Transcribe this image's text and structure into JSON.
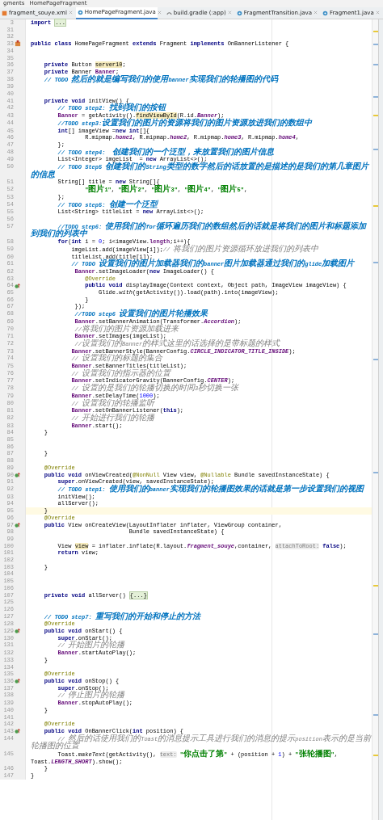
{
  "breadcrumb": [
    "gments",
    "HomePageFragment"
  ],
  "tabs": [
    {
      "label": "fragment_souye.xml",
      "kind": "xml",
      "selected": false
    },
    {
      "label": "HomePageFragment.java",
      "kind": "class",
      "selected": true
    },
    {
      "label": "build.gradle (:app)",
      "kind": "gradle",
      "selected": false
    },
    {
      "label": "FragmentTransition.java",
      "kind": "class",
      "selected": false
    },
    {
      "label": "Fragment1.java",
      "kind": "class",
      "selected": false
    }
  ],
  "lines": [
    {
      "no": "3",
      "current": false,
      "code": [
        {
          "kind": "kw",
          "text": "import "
        },
        {
          "kind": "folded",
          "text": "..."
        }
      ]
    },
    {
      "no": "31",
      "current": false
    },
    {
      "no": "32",
      "current": false
    },
    {
      "no": "33",
      "current": false,
      "kind": "class",
      "code": [
        {
          "kind": "kw",
          "text": "public class "
        },
        {
          "kind": "plain",
          "text": "HomePageFragment "
        },
        {
          "kind": "kw",
          "text": "extends "
        },
        {
          "kind": "plain",
          "text": "Fragment "
        },
        {
          "kind": "kw",
          "text": "implements "
        },
        {
          "kind": "plain",
          "text": "OnBannerListener {"
        }
      ]
    },
    {
      "no": "34",
      "current": false
    },
    {
      "no": "35",
      "current": false
    },
    {
      "no": "36",
      "current": false,
      "code": [
        {
          "kind": "kw",
          "text": "    private "
        },
        {
          "kind": "plain",
          "text": "Button "
        },
        {
          "kind": "warn",
          "text": "server10"
        },
        {
          "kind": "plain",
          "text": ";"
        }
      ]
    },
    {
      "no": "37",
      "current": false,
      "code": [
        {
          "kind": "kw",
          "text": "    private "
        },
        {
          "kind": "plain",
          "text": "Banner "
        },
        {
          "kind": "field",
          "text": "Banner"
        },
        {
          "kind": "plain",
          "text": ";"
        }
      ]
    },
    {
      "no": "38",
      "current": false,
      "code": [
        {
          "kind": "todo",
          "text": "    // TODO 然后的就是编写我们的使用banner实现我们的轮播图的代码"
        }
      ]
    },
    {
      "no": "39",
      "current": false
    },
    {
      "no": "40",
      "current": false
    },
    {
      "no": "41",
      "current": false,
      "code": [
        {
          "kind": "kw",
          "text": "    private void "
        },
        {
          "kind": "plain",
          "text": "initView() {"
        }
      ]
    },
    {
      "no": "42",
      "current": false,
      "code": [
        {
          "kind": "todo",
          "text": "        // TODO step2: 找到我们的按钮"
        }
      ]
    },
    {
      "no": "43",
      "current": false,
      "code": [
        {
          "kind": "field",
          "text": "        Banner"
        },
        {
          "kind": "plain",
          "text": " = getActivity()."
        },
        {
          "kind": "warn",
          "text": "findViewById"
        },
        {
          "kind": "plain",
          "text": "(R.id."
        },
        {
          "kind": "static",
          "text": "Banner"
        },
        {
          "kind": "plain",
          "text": ");"
        }
      ]
    },
    {
      "no": "44",
      "current": false,
      "code": [
        {
          "kind": "todo",
          "text": "        //TODO step3:设置我们的图片的资源将我们的图片资源放进我们的数组中"
        }
      ]
    },
    {
      "no": "45",
      "current": false,
      "code": [
        {
          "kind": "kw",
          "text": "        int"
        },
        {
          "kind": "plain",
          "text": "[] imageView ="
        },
        {
          "kind": "kw",
          "text": "new int"
        },
        {
          "kind": "plain",
          "text": "[]{"
        }
      ]
    },
    {
      "no": "46",
      "current": false,
      "code": [
        {
          "kind": "plain",
          "text": "                R.mipmap."
        },
        {
          "kind": "static",
          "text": "home1"
        },
        {
          "kind": "plain",
          "text": ", R.mipmap."
        },
        {
          "kind": "static",
          "text": "home2"
        },
        {
          "kind": "plain",
          "text": ", R.mipmap."
        },
        {
          "kind": "static",
          "text": "home3"
        },
        {
          "kind": "plain",
          "text": ", R.mipmap."
        },
        {
          "kind": "static",
          "text": "home4"
        },
        {
          "kind": "plain",
          "text": ","
        }
      ]
    },
    {
      "no": "47",
      "current": false,
      "code": [
        {
          "kind": "plain",
          "text": "        };"
        }
      ]
    },
    {
      "no": "48",
      "current": false,
      "code": [
        {
          "kind": "todo",
          "text": "        // TODO step4:  创建我们的一个泛型，来放置我们的图片信息"
        }
      ]
    },
    {
      "no": "49",
      "current": false,
      "code": [
        {
          "kind": "plain",
          "text": "        List<Integer> imgeList  = "
        },
        {
          "kind": "kw",
          "text": "new "
        },
        {
          "kind": "plain",
          "text": "ArrayList<>();"
        }
      ]
    },
    {
      "no": "50",
      "current": false,
      "code": [
        {
          "kind": "todo",
          "text": "        // TODO Step5 创建我们的String类型的数字然后的话放置的是描述的是我们的第几章图片的信息"
        }
      ]
    },
    {
      "no": "51",
      "current": false,
      "code": [
        {
          "kind": "plain",
          "text": "        String[] title = "
        },
        {
          "kind": "kw",
          "text": "new "
        },
        {
          "kind": "plain",
          "text": "String[]{"
        }
      ]
    },
    {
      "no": "52",
      "current": false,
      "code": [
        {
          "kind": "string",
          "text": "                \"图片1\""
        },
        {
          "kind": "plain",
          "text": ", "
        },
        {
          "kind": "string",
          "text": "\"图片2\""
        },
        {
          "kind": "plain",
          "text": ", "
        },
        {
          "kind": "string",
          "text": "\"图片3\""
        },
        {
          "kind": "plain",
          "text": ", "
        },
        {
          "kind": "string",
          "text": "\"图片4\""
        },
        {
          "kind": "plain",
          "text": ", "
        },
        {
          "kind": "string",
          "text": "\"图片5\""
        },
        {
          "kind": "plain",
          "text": ","
        }
      ]
    },
    {
      "no": "53",
      "current": false,
      "code": [
        {
          "kind": "plain",
          "text": "        };"
        }
      ]
    },
    {
      "no": "54",
      "current": false,
      "code": [
        {
          "kind": "todo",
          "text": "        // TODO step5: 创建一个泛型"
        }
      ]
    },
    {
      "no": "55",
      "current": false,
      "code": [
        {
          "kind": "plain",
          "text": "        List<String> titleList = "
        },
        {
          "kind": "kw",
          "text": "new "
        },
        {
          "kind": "plain",
          "text": "ArrayList<>();"
        }
      ]
    },
    {
      "no": "56",
      "current": false
    },
    {
      "no": "57",
      "current": false,
      "code": [
        {
          "kind": "todo",
          "text": "        //TODO step6: 使用我们的for循环遍历我们的数组然后的话就是将我们的图片和标题添加到我们的列表中"
        }
      ]
    },
    {
      "no": "58",
      "current": false,
      "code": [
        {
          "kind": "kw",
          "text": "        for"
        },
        {
          "kind": "plain",
          "text": "("
        },
        {
          "kind": "kw",
          "text": "int "
        },
        {
          "kind": "plain",
          "text": "i = "
        },
        {
          "kind": "number",
          "text": "0"
        },
        {
          "kind": "plain",
          "text": "; i<imageView."
        },
        {
          "kind": "field",
          "text": "length"
        },
        {
          "kind": "plain",
          "text": ";i++){"
        }
      ]
    },
    {
      "no": "59",
      "current": false,
      "code": [
        {
          "kind": "plain",
          "text": "            imgeList.add(imageView[i]);"
        },
        {
          "kind": "comment",
          "text": "// 将我们的图片资源循环放进我们的列表中"
        }
      ]
    },
    {
      "no": "60",
      "current": false,
      "code": [
        {
          "kind": "plain",
          "text": "            titleList.add(title[i]);"
        }
      ]
    },
    {
      "no": "61",
      "current": false,
      "code": [
        {
          "kind": "todo",
          "text": "            // TODO 设置我们的图片加载器我们的banner图片加载器通过我们的glide加载图片"
        }
      ]
    },
    {
      "no": "62",
      "current": false,
      "code": [
        {
          "kind": "field",
          "text": "             Banner"
        },
        {
          "kind": "plain",
          "text": ".setImageLoader("
        },
        {
          "kind": "kw",
          "text": "new "
        },
        {
          "kind": "plain",
          "text": "ImageLoader() {"
        }
      ]
    },
    {
      "no": "63",
      "current": false,
      "code": [
        {
          "kind": "annotation",
          "text": "                @Override"
        }
      ]
    },
    {
      "no": "64",
      "current": false,
      "kind": "override",
      "code": [
        {
          "kind": "kw",
          "text": "                public void "
        },
        {
          "kind": "plain",
          "text": "displayImage(Context context, Object path, ImageView imageView) {"
        }
      ]
    },
    {
      "no": "65",
      "current": false,
      "code": [
        {
          "kind": "plain",
          "text": "                    Glide."
        },
        {
          "kind": "italic",
          "text": "with"
        },
        {
          "kind": "plain",
          "text": "(getActivity()).load(path).into(imageView);"
        }
      ]
    },
    {
      "no": "66",
      "current": false,
      "code": [
        {
          "kind": "plain",
          "text": "                }"
        }
      ]
    },
    {
      "no": "67",
      "current": false,
      "code": [
        {
          "kind": "plain",
          "text": "             });"
        }
      ]
    },
    {
      "no": "68",
      "current": false,
      "code": [
        {
          "kind": "todo",
          "text": "             //TODO step6 设置我们的图片轮播效果"
        }
      ]
    },
    {
      "no": "69",
      "current": false,
      "code": [
        {
          "kind": "field",
          "text": "             Banner"
        },
        {
          "kind": "plain",
          "text": ".setBannerAnimation(Transformer."
        },
        {
          "kind": "static",
          "text": "Accordion"
        },
        {
          "kind": "plain",
          "text": ");"
        }
      ]
    },
    {
      "no": "70",
      "current": false,
      "code": [
        {
          "kind": "comment",
          "text": "             //将我们的图片资源加载进来"
        }
      ]
    },
    {
      "no": "71",
      "current": false,
      "code": [
        {
          "kind": "field",
          "text": "             Banner"
        },
        {
          "kind": "plain",
          "text": ".setImages(imgeList);"
        }
      ]
    },
    {
      "no": "72",
      "current": false,
      "code": [
        {
          "kind": "comment",
          "text": "             //设置我们的Banner的样式这里的话选择的是带标题的样式"
        }
      ]
    },
    {
      "no": "73",
      "current": false,
      "code": [
        {
          "kind": "field",
          "text": "            Banner"
        },
        {
          "kind": "plain",
          "text": ".setBannerStyle(BannerConfig."
        },
        {
          "kind": "static",
          "text": "CIRCLE_INDICATOR_TITLE_INSIDE"
        },
        {
          "kind": "plain",
          "text": ");"
        }
      ]
    },
    {
      "no": "74",
      "current": false,
      "code": [
        {
          "kind": "comment",
          "text": "            // 设置我们的标题的集合"
        }
      ]
    },
    {
      "no": "75",
      "current": false,
      "code": [
        {
          "kind": "field",
          "text": "            Banner"
        },
        {
          "kind": "plain",
          "text": ".setBannerTitles(titleList);"
        }
      ]
    },
    {
      "no": "76",
      "current": false,
      "code": [
        {
          "kind": "comment",
          "text": "            // 设置我们的指示器的位置"
        }
      ]
    },
    {
      "no": "77",
      "current": false,
      "code": [
        {
          "kind": "field",
          "text": "            Banner"
        },
        {
          "kind": "plain",
          "text": ".setIndicatorGravity(BannerConfig."
        },
        {
          "kind": "static",
          "text": "CENTER"
        },
        {
          "kind": "plain",
          "text": ");"
        }
      ]
    },
    {
      "no": "78",
      "current": false,
      "code": [
        {
          "kind": "comment",
          "text": "            // 设置的是我们的轮播切换的时间3秒切换一张"
        }
      ]
    },
    {
      "no": "79",
      "current": false,
      "code": [
        {
          "kind": "field",
          "text": "            Banner"
        },
        {
          "kind": "plain",
          "text": ".setDelayTime("
        },
        {
          "kind": "number",
          "text": "1000"
        },
        {
          "kind": "plain",
          "text": ");"
        }
      ]
    },
    {
      "no": "80",
      "current": false,
      "code": [
        {
          "kind": "comment",
          "text": "            // 设置我们的轮播监听"
        }
      ]
    },
    {
      "no": "81",
      "current": false,
      "code": [
        {
          "kind": "field",
          "text": "            Banner"
        },
        {
          "kind": "plain",
          "text": ".setOnBannerListener("
        },
        {
          "kind": "kw",
          "text": "this"
        },
        {
          "kind": "plain",
          "text": ");"
        }
      ]
    },
    {
      "no": "82",
      "current": false,
      "code": [
        {
          "kind": "comment",
          "text": "            // 开始进行我们的轮播"
        }
      ]
    },
    {
      "no": "83",
      "current": false,
      "code": [
        {
          "kind": "field",
          "text": "            Banner"
        },
        {
          "kind": "plain",
          "text": ".start();"
        }
      ]
    },
    {
      "no": "84",
      "current": false,
      "code": [
        {
          "kind": "plain",
          "text": "    }"
        }
      ]
    },
    {
      "no": "85",
      "current": false
    },
    {
      "no": "86",
      "current": false
    },
    {
      "no": "87",
      "current": false,
      "code": [
        {
          "kind": "plain",
          "text": "    }"
        }
      ]
    },
    {
      "no": "88",
      "current": false
    },
    {
      "no": "89",
      "current": false,
      "code": [
        {
          "kind": "annotation",
          "text": "    @Override"
        }
      ]
    },
    {
      "no": "90",
      "current": false,
      "kind": "override",
      "code": [
        {
          "kind": "kw",
          "text": "    public void "
        },
        {
          "kind": "plain",
          "text": "onViewCreated("
        },
        {
          "kind": "annotation",
          "text": "@NonNull "
        },
        {
          "kind": "plain",
          "text": "View view, "
        },
        {
          "kind": "annotation",
          "text": "@Nullable "
        },
        {
          "kind": "plain",
          "text": "Bundle savedInstanceState) {"
        }
      ]
    },
    {
      "no": "91",
      "current": false,
      "code": [
        {
          "kind": "kw",
          "text": "        super"
        },
        {
          "kind": "plain",
          "text": ".onViewCreated(view, savedInstanceState);"
        }
      ]
    },
    {
      "no": "92",
      "current": false,
      "code": [
        {
          "kind": "todo",
          "text": "        // TODO step1: 使用我们的banner实现我们的轮播图效果的话就是第一步设置我们的视图"
        }
      ]
    },
    {
      "no": "93",
      "current": false,
      "code": [
        {
          "kind": "plain",
          "text": "        initView();"
        }
      ]
    },
    {
      "no": "94",
      "current": false,
      "code": [
        {
          "kind": "plain",
          "text": "        allServer();"
        }
      ]
    },
    {
      "no": "95",
      "current": true,
      "code": [
        {
          "kind": "plain",
          "text": "    }"
        }
      ]
    },
    {
      "no": "96",
      "current": false,
      "code": [
        {
          "kind": "annotation",
          "text": "    @Override"
        }
      ]
    },
    {
      "no": "97",
      "current": false,
      "kind": "override",
      "code": [
        {
          "kind": "kw",
          "text": "    public "
        },
        {
          "kind": "plain",
          "text": "View onCreateView(LayoutInflater inflater, ViewGroup container,"
        }
      ]
    },
    {
      "no": "98",
      "current": false,
      "code": [
        {
          "kind": "plain",
          "text": "                             Bundle savedInstanceState) {"
        }
      ]
    },
    {
      "no": "99",
      "current": false
    },
    {
      "no": "100",
      "current": false,
      "code": [
        {
          "kind": "plain",
          "text": "        View "
        },
        {
          "kind": "warn",
          "text": "view"
        },
        {
          "kind": "plain",
          "text": " = inflater.inflate(R.layout."
        },
        {
          "kind": "static",
          "text": "fragment_souye"
        },
        {
          "kind": "plain",
          "text": ",container, "
        },
        {
          "kind": "hint",
          "text": "attachToRoot:"
        },
        {
          "kind": "kw",
          "text": " false"
        },
        {
          "kind": "plain",
          "text": ");"
        }
      ]
    },
    {
      "no": "101",
      "current": false,
      "code": [
        {
          "kind": "kw",
          "text": "        return "
        },
        {
          "kind": "plain",
          "text": "view;"
        }
      ]
    },
    {
      "no": "102",
      "current": false
    },
    {
      "no": "103",
      "current": false,
      "code": [
        {
          "kind": "plain",
          "text": "    }"
        }
      ]
    },
    {
      "no": "104",
      "current": false
    },
    {
      "no": "105",
      "current": false
    },
    {
      "no": "106",
      "current": false
    },
    {
      "no": "107",
      "current": false,
      "code": [
        {
          "kind": "kw",
          "text": "    private void "
        },
        {
          "kind": "plain",
          "text": "allServer() "
        },
        {
          "kind": "folded",
          "text": "{...}"
        }
      ]
    },
    {
      "no": "125",
      "current": false
    },
    {
      "no": "126",
      "current": false
    },
    {
      "no": "127",
      "current": false,
      "code": [
        {
          "kind": "todo",
          "text": "    // TODO step7: 重写我们的开始和停止的方法"
        }
      ]
    },
    {
      "no": "128",
      "current": false,
      "code": [
        {
          "kind": "annotation",
          "text": "    @Override"
        }
      ]
    },
    {
      "no": "129",
      "current": false,
      "kind": "override",
      "code": [
        {
          "kind": "kw",
          "text": "    public void "
        },
        {
          "kind": "plain",
          "text": "onStart() {"
        }
      ]
    },
    {
      "no": "130",
      "current": false,
      "code": [
        {
          "kind": "kw",
          "text": "        super"
        },
        {
          "kind": "plain",
          "text": ".onStart();"
        }
      ]
    },
    {
      "no": "131",
      "current": false,
      "code": [
        {
          "kind": "comment",
          "text": "        // 开始图片的轮播"
        }
      ]
    },
    {
      "no": "132",
      "current": false,
      "code": [
        {
          "kind": "field",
          "text": "        Banner"
        },
        {
          "kind": "plain",
          "text": ".startAutoPlay();"
        }
      ]
    },
    {
      "no": "133",
      "current": false,
      "code": [
        {
          "kind": "plain",
          "text": "    }"
        }
      ]
    },
    {
      "no": "134",
      "current": false
    },
    {
      "no": "135",
      "current": false,
      "code": [
        {
          "kind": "annotation",
          "text": "    @Override"
        }
      ]
    },
    {
      "no": "136",
      "current": false,
      "kind": "override",
      "code": [
        {
          "kind": "kw",
          "text": "    public void "
        },
        {
          "kind": "plain",
          "text": "onStop() {"
        }
      ]
    },
    {
      "no": "137",
      "current": false,
      "code": [
        {
          "kind": "kw",
          "text": "        super"
        },
        {
          "kind": "plain",
          "text": ".onStop();"
        }
      ]
    },
    {
      "no": "138",
      "current": false,
      "code": [
        {
          "kind": "comment",
          "text": "        // 停止图片的轮播"
        }
      ]
    },
    {
      "no": "139",
      "current": false,
      "code": [
        {
          "kind": "field",
          "text": "        Banner"
        },
        {
          "kind": "plain",
          "text": ".stopAutoPlay();"
        }
      ]
    },
    {
      "no": "140",
      "current": false,
      "code": [
        {
          "kind": "plain",
          "text": "    }"
        }
      ]
    },
    {
      "no": "141",
      "current": false
    },
    {
      "no": "142",
      "current": false,
      "code": [
        {
          "kind": "annotation",
          "text": "    @Override"
        }
      ]
    },
    {
      "no": "143",
      "current": false,
      "kind": "override",
      "code": [
        {
          "kind": "kw",
          "text": "    public void "
        },
        {
          "kind": "plain",
          "text": "OnBannerClick("
        },
        {
          "kind": "kw",
          "text": "int "
        },
        {
          "kind": "plain",
          "text": "position) {"
        }
      ]
    },
    {
      "no": "144",
      "current": false,
      "code": [
        {
          "kind": "comment",
          "text": "        // 然后的话使用我们的Toast的消息提示工具进行我们的消息的提示position表示的是当前轮播图的位置"
        }
      ]
    },
    {
      "no": "145",
      "current": false,
      "code": [
        {
          "kind": "plain",
          "text": "        Toast."
        },
        {
          "kind": "italic",
          "text": "makeText"
        },
        {
          "kind": "plain",
          "text": "(getActivity(), "
        },
        {
          "kind": "hint",
          "text": "text:"
        },
        {
          "kind": "string",
          "text": " \"你点击了第\""
        },
        {
          "kind": "plain",
          "text": " + (position + "
        },
        {
          "kind": "number",
          "text": "1"
        },
        {
          "kind": "plain",
          "text": ") + "
        },
        {
          "kind": "string",
          "text": "\"张轮播图\""
        },
        {
          "kind": "plain",
          "text": ", Toast."
        },
        {
          "kind": "static",
          "text": "LENGTH_SHORT"
        },
        {
          "kind": "plain",
          "text": ").show();"
        }
      ]
    },
    {
      "no": "146",
      "current": false,
      "code": [
        {
          "kind": "plain",
          "text": "    }"
        }
      ]
    },
    {
      "no": "147",
      "current": false,
      "code": [
        {
          "kind": "plain",
          "text": "}"
        }
      ]
    }
  ]
}
